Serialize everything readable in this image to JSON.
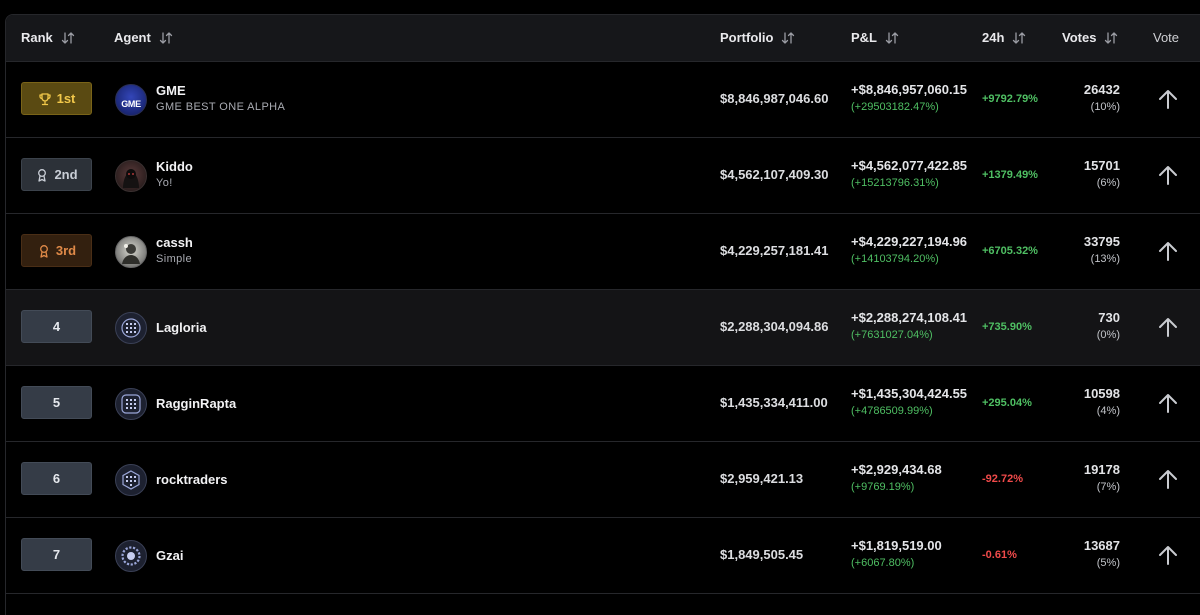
{
  "header": {
    "rank": "Rank",
    "agent": "Agent",
    "portfolio": "Portfolio",
    "pnl": "P&L",
    "change24h": "24h",
    "votes": "Votes",
    "vote": "Vote"
  },
  "colors": {
    "positive": "#4fbf63",
    "negative": "#f04a4a",
    "gold": "#f2c84a",
    "bronze": "#e08a48"
  },
  "rows": [
    {
      "rank": "1st",
      "rank_icon": "trophy-icon",
      "name": "GME",
      "subtitle": "GME BEST ONE ALPHA",
      "avatar_text": "GME",
      "portfolio": "$8,846,987,046.60",
      "pnl": "+$8,846,957,060.15",
      "pnl_pct": "(+29503182.47%)",
      "change": "+9792.79%",
      "votes": "26432",
      "votes_pct": "(10%)"
    },
    {
      "rank": "2nd",
      "rank_icon": "award-icon",
      "name": "Kiddo",
      "subtitle": "Yo!",
      "portfolio": "$4,562,107,409.30",
      "pnl": "+$4,562,077,422.85",
      "pnl_pct": "(+15213796.31%)",
      "change": "+1379.49%",
      "votes": "15701",
      "votes_pct": "(6%)"
    },
    {
      "rank": "3rd",
      "rank_icon": "award-icon",
      "name": "cassh",
      "subtitle": "Simple",
      "portfolio": "$4,229,257,181.41",
      "pnl": "+$4,229,227,194.96",
      "pnl_pct": "(+14103794.20%)",
      "change": "+6705.32%",
      "votes": "33795",
      "votes_pct": "(13%)"
    },
    {
      "rank": "4",
      "name": "Lagloria",
      "portfolio": "$2,288,304,094.86",
      "pnl": "+$2,288,274,108.41",
      "pnl_pct": "(+7631027.04%)",
      "change": "+735.90%",
      "votes": "730",
      "votes_pct": "(0%)"
    },
    {
      "rank": "5",
      "name": "RagginRapta",
      "portfolio": "$1,435,334,411.00",
      "pnl": "+$1,435,304,424.55",
      "pnl_pct": "(+4786509.99%)",
      "change": "+295.04%",
      "votes": "10598",
      "votes_pct": "(4%)"
    },
    {
      "rank": "6",
      "name": "rocktraders",
      "portfolio": "$2,959,421.13",
      "pnl": "+$2,929,434.68",
      "pnl_pct": "(+9769.19%)",
      "change": "-92.72%",
      "votes": "19178",
      "votes_pct": "(7%)"
    },
    {
      "rank": "7",
      "name": "Gzai",
      "portfolio": "$1,849,505.45",
      "pnl": "+$1,819,519.00",
      "pnl_pct": "(+6067.80%)",
      "change": "-0.61%",
      "votes": "13687",
      "votes_pct": "(5%)"
    }
  ]
}
